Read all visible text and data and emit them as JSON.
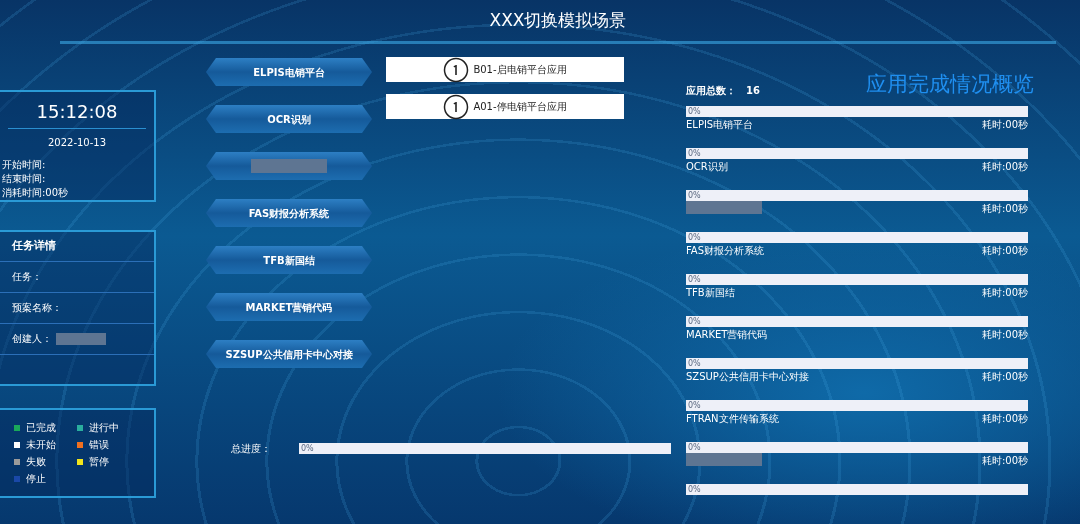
{
  "title": "XXX切换模拟场景",
  "clock": {
    "time": "15:12:08",
    "date": "2022-10-13",
    "lines": [
      "开始时间:",
      "结束时间:",
      "消耗时间:00秒"
    ]
  },
  "details": {
    "title": "任务详情",
    "fields": [
      {
        "label": "任务：",
        "redacted": false
      },
      {
        "label": "预案名称：",
        "redacted": false
      },
      {
        "label": "创建人：",
        "redacted": true
      }
    ]
  },
  "legend": [
    {
      "label": "已完成",
      "color": "#1aa85a"
    },
    {
      "label": "进行中",
      "color": "#2aae9e"
    },
    {
      "label": "未开始",
      "color": "#ffffff"
    },
    {
      "label": "错误",
      "color": "#f07020"
    },
    {
      "label": "失败",
      "color": "#9a9a9a"
    },
    {
      "label": "暂停",
      "color": "#f2e51c"
    },
    {
      "label": "停止",
      "color": "#1a48a8"
    }
  ],
  "apps": [
    {
      "label": "ELPIS电销平台",
      "redacted": false
    },
    {
      "label": "OCR识别",
      "redacted": false
    },
    {
      "redacted": true
    },
    {
      "label": "FAS财报分析系统",
      "redacted": false
    },
    {
      "label": "TFB新国结",
      "redacted": false
    },
    {
      "label": "MARKET营销代码",
      "redacted": false
    },
    {
      "label": "SZSUP公共信用卡中心对接",
      "redacted": false
    }
  ],
  "tasks": [
    {
      "label": "B01-启电销平台应用"
    },
    {
      "label": "A01-停电销平台应用"
    }
  ],
  "total_progress": {
    "label": "总进度：",
    "level": 0,
    "reading": "0%"
  },
  "overview": {
    "count_label": "应用总数：",
    "count": "16",
    "heading": "应用完成情况概览",
    "items": [
      {
        "name": "ELPIS电销平台",
        "redacted": false,
        "level": 0,
        "reading": "0%",
        "time": "耗时:00秒"
      },
      {
        "name": "OCR识别",
        "redacted": false,
        "level": 0,
        "reading": "0%",
        "time": "耗时:00秒"
      },
      {
        "redacted": true,
        "level": 0,
        "reading": "0%",
        "time": "耗时:00秒"
      },
      {
        "name": "FAS财报分析系统",
        "redacted": false,
        "level": 0,
        "reading": "0%",
        "time": "耗时:00秒"
      },
      {
        "name": "TFB新国结",
        "redacted": false,
        "level": 0,
        "reading": "0%",
        "time": "耗时:00秒"
      },
      {
        "name": "MARKET营销代码",
        "redacted": false,
        "level": 0,
        "reading": "0%",
        "time": "耗时:00秒"
      },
      {
        "name": "SZSUP公共信用卡中心对接",
        "redacted": false,
        "level": 0,
        "reading": "0%",
        "time": "耗时:00秒"
      },
      {
        "name": "FTRAN文件传输系统",
        "redacted": false,
        "level": 0,
        "reading": "0%",
        "time": "耗时:00秒"
      },
      {
        "redacted": true,
        "level": 0,
        "reading": "0%",
        "time": "耗时:00秒"
      },
      {
        "redacted": false,
        "level": 0,
        "reading": "0%"
      }
    ]
  }
}
